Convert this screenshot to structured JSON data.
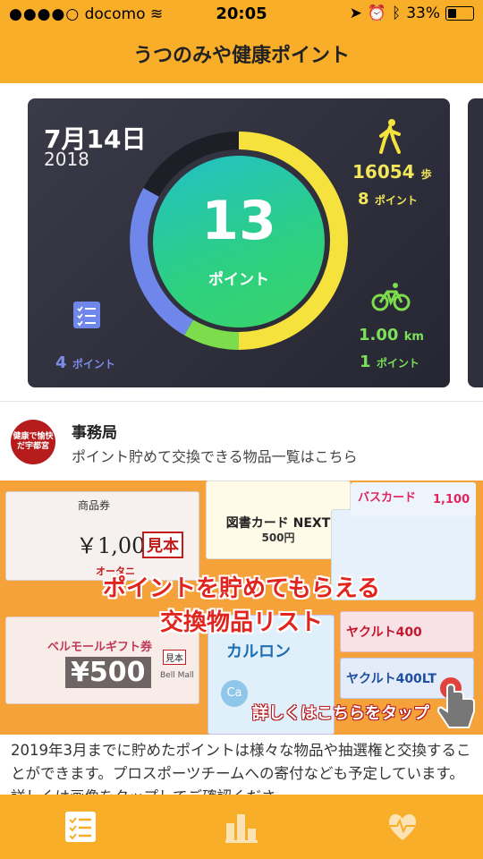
{
  "status": {
    "carrier": "docomo",
    "time": "20:05",
    "battery": "33%"
  },
  "header": {
    "title": "うつのみや健康ポイント"
  },
  "card": {
    "date": "7月14日",
    "year": "2018",
    "total_points": "13",
    "total_label": "ポイント",
    "walk": {
      "steps": "16054",
      "steps_unit": "歩",
      "points": "8",
      "points_unit": "ポイント"
    },
    "bike": {
      "distance": "1.00",
      "distance_unit": "km",
      "points": "1",
      "points_unit": "ポイント"
    },
    "tasks": {
      "points": "4",
      "points_unit": "ポイント"
    },
    "colors": {
      "walk": "#f5e23c",
      "bike": "#7ddc4c",
      "tasks": "#6f86ea"
    }
  },
  "office": {
    "seal": "健康で愉快だ宇都宮",
    "name": "事務局",
    "desc": "ポイント貯めて交換できる物品一覧はこちら"
  },
  "banner": {
    "ticket1_label": "商品券",
    "ticket1_amount": "￥1,000.",
    "ticket1_mihon": "見本",
    "ticket1_store": "オータニ",
    "ticket2_label": "図書カード NEXT",
    "ticket2_amount": "500円",
    "ticket3_label": "バスカード",
    "ticket3_amount": "1,100",
    "ticket4_label": "ベルモールギフト券",
    "ticket4_amount": "¥500",
    "ticket4_mihon": "見本",
    "ticket4_logo": "Bell Mall",
    "ticket5_label": "カルロン",
    "ticket5_ca": "Ca",
    "ticket6_label": "ヤクルト400",
    "ticket7_label": "ヤクルト400LT",
    "headline1": "ポイントを貯めてもらえる",
    "headline2": "交換物品リスト",
    "tap": "詳しくはこちらをタップ"
  },
  "description": "2019年3月までに貯めたポイントは様々な物品や抽選権と交換することができます。プロスポーツチームへの寄付なども予定しています。詳しくは画像をタップしてご確認くださ",
  "tabs": [
    {
      "icon": "checklist-icon"
    },
    {
      "icon": "bar-chart-icon"
    },
    {
      "icon": "heart-monitor-icon"
    }
  ]
}
